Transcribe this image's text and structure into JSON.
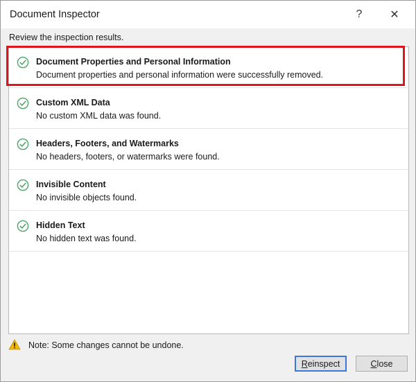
{
  "window": {
    "title": "Document Inspector",
    "help_glyph": "?",
    "close_glyph": "✕"
  },
  "subtitle": "Review the inspection results.",
  "results": [
    {
      "title": "Document Properties and Personal Information",
      "description": "Document properties and personal information were successfully removed.",
      "status_icon": "check-circle-icon",
      "highlighted": true
    },
    {
      "title": "Custom XML Data",
      "description": "No custom XML data was found.",
      "status_icon": "check-circle-icon"
    },
    {
      "title": "Headers, Footers, and Watermarks",
      "description": "No headers, footers, or watermarks were found.",
      "status_icon": "check-circle-icon"
    },
    {
      "title": "Invisible Content",
      "description": "No invisible objects found.",
      "status_icon": "check-circle-icon"
    },
    {
      "title": "Hidden Text",
      "description": "No hidden text was found.",
      "status_icon": "check-circle-icon"
    }
  ],
  "footer": {
    "note": "Note: Some changes cannot be undone.",
    "note_icon": "warning-icon"
  },
  "buttons": {
    "reinspect": {
      "mnemonic": "R",
      "rest": "einspect"
    },
    "close": {
      "mnemonic": "C",
      "rest": "lose"
    }
  },
  "colors": {
    "check": "#4aa564",
    "highlight_border": "#e0141b",
    "warning": "#f2b807",
    "default_button_border": "#3c78d8"
  }
}
